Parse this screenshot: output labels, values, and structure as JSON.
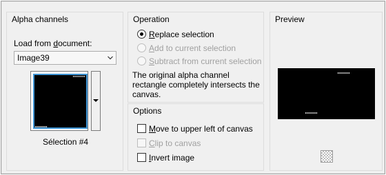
{
  "alpha_channels": {
    "title": "Alpha channels",
    "load_from_label_pre": "Load from ",
    "load_from_label_u": "d",
    "load_from_label_post": "ocument:",
    "document_select_value": "Image39",
    "selection_caption": "Sélection #4"
  },
  "operation": {
    "title": "Operation",
    "options": [
      {
        "u": "R",
        "rest": "eplace selection",
        "checked": true,
        "enabled": true
      },
      {
        "u": "A",
        "rest": "dd to current selection",
        "checked": false,
        "enabled": false
      },
      {
        "u": "S",
        "rest": "ubtract from current selection",
        "checked": false,
        "enabled": false
      }
    ],
    "message": "The original alpha channel rectangle completely intersects the canvas."
  },
  "options": {
    "title": "Options",
    "checkboxes": [
      {
        "u": "M",
        "rest": "ove to upper left of canvas",
        "checked": false,
        "enabled": true
      },
      {
        "u": "C",
        "rest": "lip to canvas",
        "checked": false,
        "enabled": false
      },
      {
        "u": "I",
        "rest": "nvert image",
        "checked": false,
        "enabled": true
      }
    ]
  },
  "preview": {
    "title": "Preview"
  },
  "icons": [
    "chevron-down-icon",
    "dropdown-arrow-icon",
    "transparency-checker-icon"
  ]
}
